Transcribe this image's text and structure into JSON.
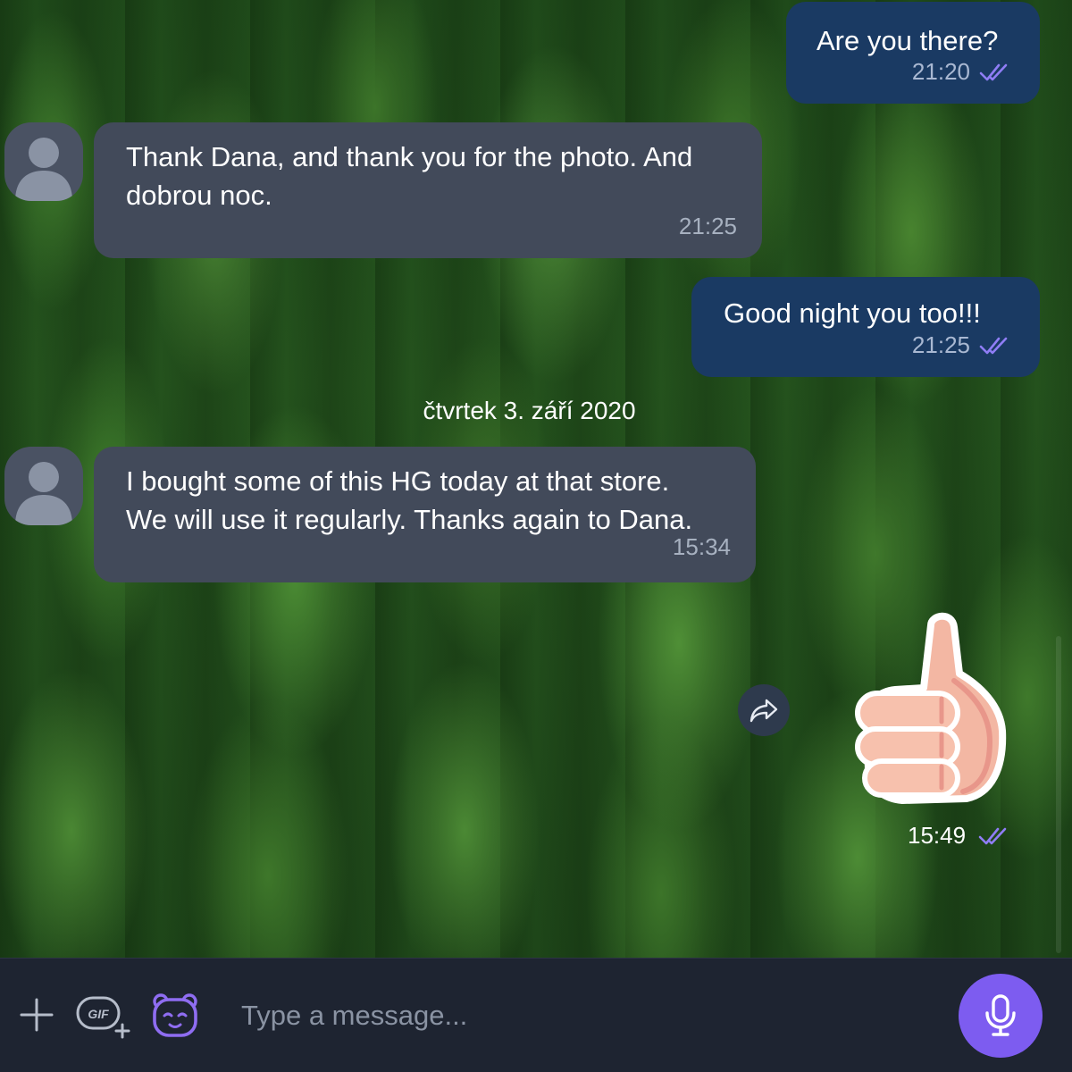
{
  "messages": [
    {
      "direction": "outgoing",
      "text": "Are you there?",
      "time": "21:20",
      "status_icon": "double-check-icon"
    },
    {
      "direction": "incoming",
      "text_lines": [
        "Thank Dana, and thank you for the photo. And",
        "dobrou noc."
      ],
      "time": "21:25",
      "avatar_icon": "user-avatar-icon"
    },
    {
      "direction": "outgoing",
      "text": "Good night you too!!!",
      "time": "21:25",
      "status_icon": "double-check-icon"
    },
    {
      "direction": "incoming",
      "text_lines": [
        "I bought some of this HG today at that store.",
        "We will use it regularly. Thanks again to Dana."
      ],
      "time": "15:34",
      "avatar_icon": "user-avatar-icon"
    },
    {
      "direction": "outgoing",
      "sticker": "thumbs-up-sticker",
      "time": "15:49",
      "status_icon": "double-check-icon"
    }
  ],
  "date_separator": "čtvrtek 3. září 2020",
  "forward_icon": "forward-icon",
  "composer": {
    "placeholder": "Type a message...",
    "value": "",
    "attach_icon": "plus-icon",
    "gif_icon": "gif-icon",
    "sticker_icon": "bear-sticker-icon",
    "mic_icon": "microphone-icon"
  },
  "colors": {
    "outgoing_bubble": "#1a3a63",
    "incoming_bubble": "#424a5a",
    "accent": "#7d5cf0",
    "composer_bg": "#1e2431"
  }
}
